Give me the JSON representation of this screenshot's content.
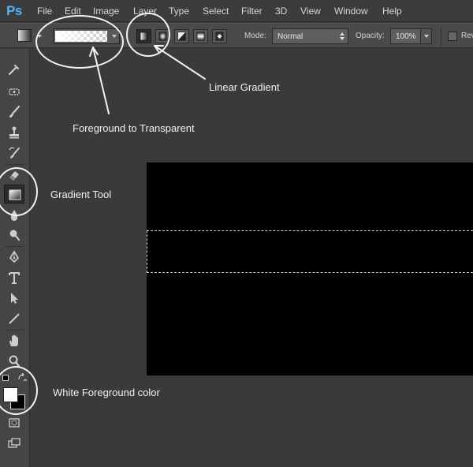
{
  "app": {
    "logo": "Ps"
  },
  "menu": [
    "File",
    "Edit",
    "Image",
    "Layer",
    "Type",
    "Select",
    "Filter",
    "3D",
    "View",
    "Window",
    "Help"
  ],
  "options_bar": {
    "mode_label": "Mode:",
    "mode_value": "Normal",
    "opacity_label": "Opacity:",
    "opacity_value": "100%",
    "reverse_label": "Rev"
  },
  "annotations": {
    "foreground_to_transparent": "Foreground to Transparent",
    "linear_gradient": "Linear Gradient",
    "gradient_tool": "Gradient Tool",
    "white_foreground": "White Foreground color"
  },
  "colors": {
    "foreground": "#ffffff",
    "background": "#000000",
    "canvas": "#000000",
    "logo": "#4fb3ff"
  },
  "icons": [
    "eyedropper-icon",
    "healing-brush-icon",
    "brush-icon",
    "clone-stamp-icon",
    "history-brush-icon",
    "eraser-icon",
    "gradient-icon",
    "blur-icon",
    "dodge-icon",
    "pen-icon",
    "type-icon",
    "path-select-icon",
    "line-icon",
    "hand-icon",
    "zoom-icon",
    "quick-mask-icon",
    "screen-mode-icon"
  ]
}
